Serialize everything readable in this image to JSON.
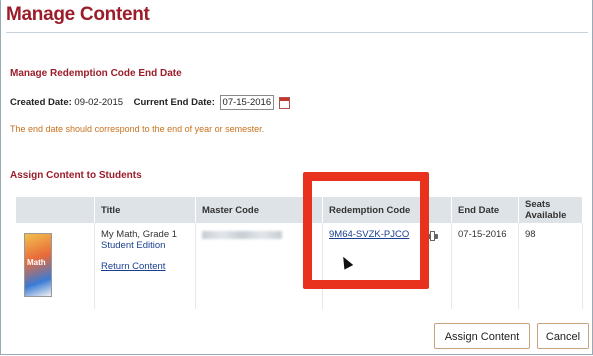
{
  "page": {
    "title": "Manage Content"
  },
  "redemption": {
    "heading": "Manage Redemption Code End Date",
    "created_label": "Created Date:",
    "created_value": "09-02-2015",
    "end_label": "Current End Date:",
    "end_value": "07-15-2016",
    "note": "The end date should correspond to the end of year or semester."
  },
  "assign": {
    "heading": "Assign Content to Students",
    "columns": [
      "Title",
      "Master Code",
      "Redemption Code",
      "End Date",
      "Seats Available"
    ],
    "row": {
      "title_line1": "My Math, Grade 1",
      "title_line2": "Student Edition",
      "return_link": "Return Content",
      "book_cover_text": "Math",
      "redemption_code": "9M64-SVZK-PJCO",
      "end_date": "07-15-2016",
      "seats_available": "98"
    }
  },
  "buttons": {
    "assign": "Assign Content",
    "cancel": "Cancel"
  },
  "colors": {
    "heading": "#9b1d2a",
    "note": "#c8711e",
    "highlight": "#e8321e",
    "link": "#1a3f8f"
  }
}
